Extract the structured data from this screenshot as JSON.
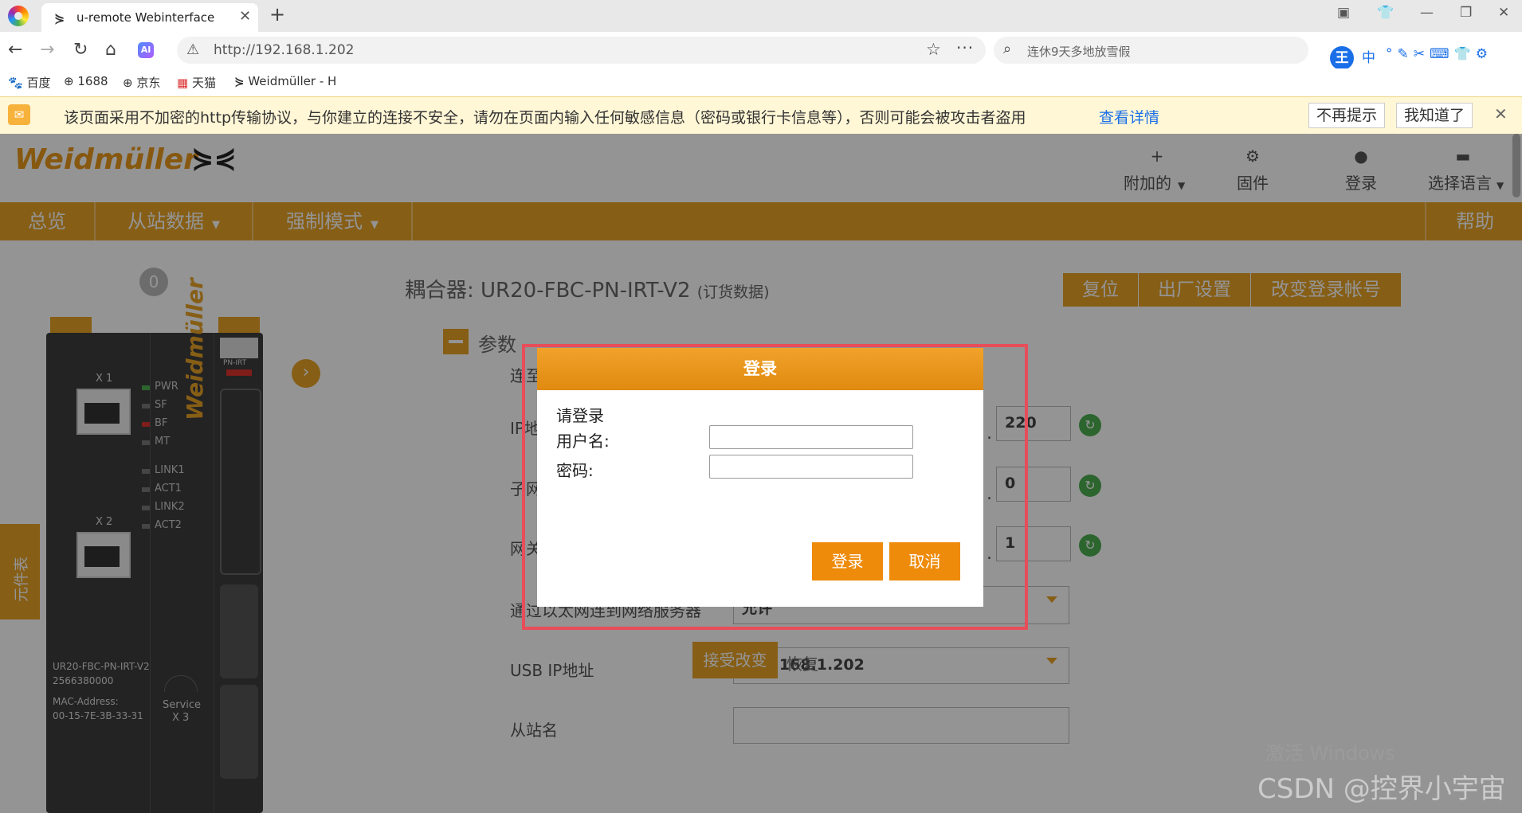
{
  "browser": {
    "tab_title": "u-remote Webinterface",
    "tab_favicon": "weidmuller-icon",
    "url": "http://192.168.1.202",
    "search_hint": "连休9天多地放雪假",
    "bookmarks": [
      "百度",
      "1688",
      "京东",
      "天猫",
      "Weidmüller - H"
    ],
    "security_warning": "该页面采用不加密的http传输协议，与你建立的连接不安全，请勿在页面内输入任何敏感信息（密码或银行卡信息等），否则可能会被攻击者盗用",
    "warning_link": "查看详情",
    "warning_buttons": [
      "不再提示",
      "我知道了"
    ],
    "ime_logo": "王",
    "ime_lang": "中"
  },
  "app": {
    "brand": "Weidmüller",
    "top_nav": [
      {
        "icon": "plus-icon",
        "label": "附加的",
        "caret": true
      },
      {
        "icon": "gear-icon",
        "label": "固件",
        "caret": false
      },
      {
        "icon": "user-icon",
        "label": "登录",
        "caret": false
      },
      {
        "icon": "chat-icon",
        "label": "选择语言",
        "caret": true
      }
    ],
    "menu": [
      "总览",
      "从站数据",
      "强制模式",
      "帮助"
    ],
    "counter": "0",
    "coupler_title": "耦合器: UR20-FBC-PN-IRT-V2",
    "coupler_sub": "(订货数据)",
    "actions": [
      "复位",
      "出厂设置",
      "改变登录帐号"
    ],
    "component_tab": "元件表",
    "params_label": "参数",
    "fields": {
      "conn_label_partial": "连至",
      "ip_label_partial": "IP地",
      "subnet_label_partial": "子网",
      "gateway_label_partial": "网关",
      "ip_last": "220",
      "subnet_last": "0",
      "gateway_last": "1",
      "eth_label": "通过以太网连到网络服务器",
      "eth_value": "允许",
      "usb_label": "USB IP地址",
      "usb_value": "192.168.1.202",
      "station_label": "从站名",
      "station_value": ""
    },
    "accept_button": "接受改变",
    "restore_link": "恢复"
  },
  "device": {
    "pn_label": "PN-IRT",
    "ports": [
      "X 1",
      "X 2"
    ],
    "leds": [
      {
        "name": "PWR",
        "color": "#4caf50"
      },
      {
        "name": "SF",
        "color": "#777777"
      },
      {
        "name": "BF",
        "color": "#d9332b"
      },
      {
        "name": "MT",
        "color": "#777777"
      },
      {
        "name": "LINK1",
        "color": "#777777"
      },
      {
        "name": "ACT1",
        "color": "#777777"
      },
      {
        "name": "LINK2",
        "color": "#777777"
      },
      {
        "name": "ACT2",
        "color": "#777777"
      }
    ],
    "model": "UR20-FBC-PN-IRT-V2",
    "serial": "2566380000",
    "mac_label": "MAC-Address:",
    "mac": "00-15-7E-3B-33-31",
    "service_label": "Service",
    "service_port": "X 3",
    "brand_vertical": "Weidmüller"
  },
  "login_dialog": {
    "title": "登录",
    "prompt": "请登录",
    "username_label": "用户名:",
    "password_label": "密码:",
    "username_value": "",
    "password_value": "",
    "login_button": "登录",
    "cancel_button": "取消"
  },
  "watermarks": {
    "windows": "激活 Windows",
    "csdn": "CSDN @控界小宇宙"
  },
  "colors": {
    "accent": "#e7a326",
    "dialog_header": "#ee8b0a",
    "highlight_border": "#e84d5a",
    "link": "#1a6fe8"
  }
}
